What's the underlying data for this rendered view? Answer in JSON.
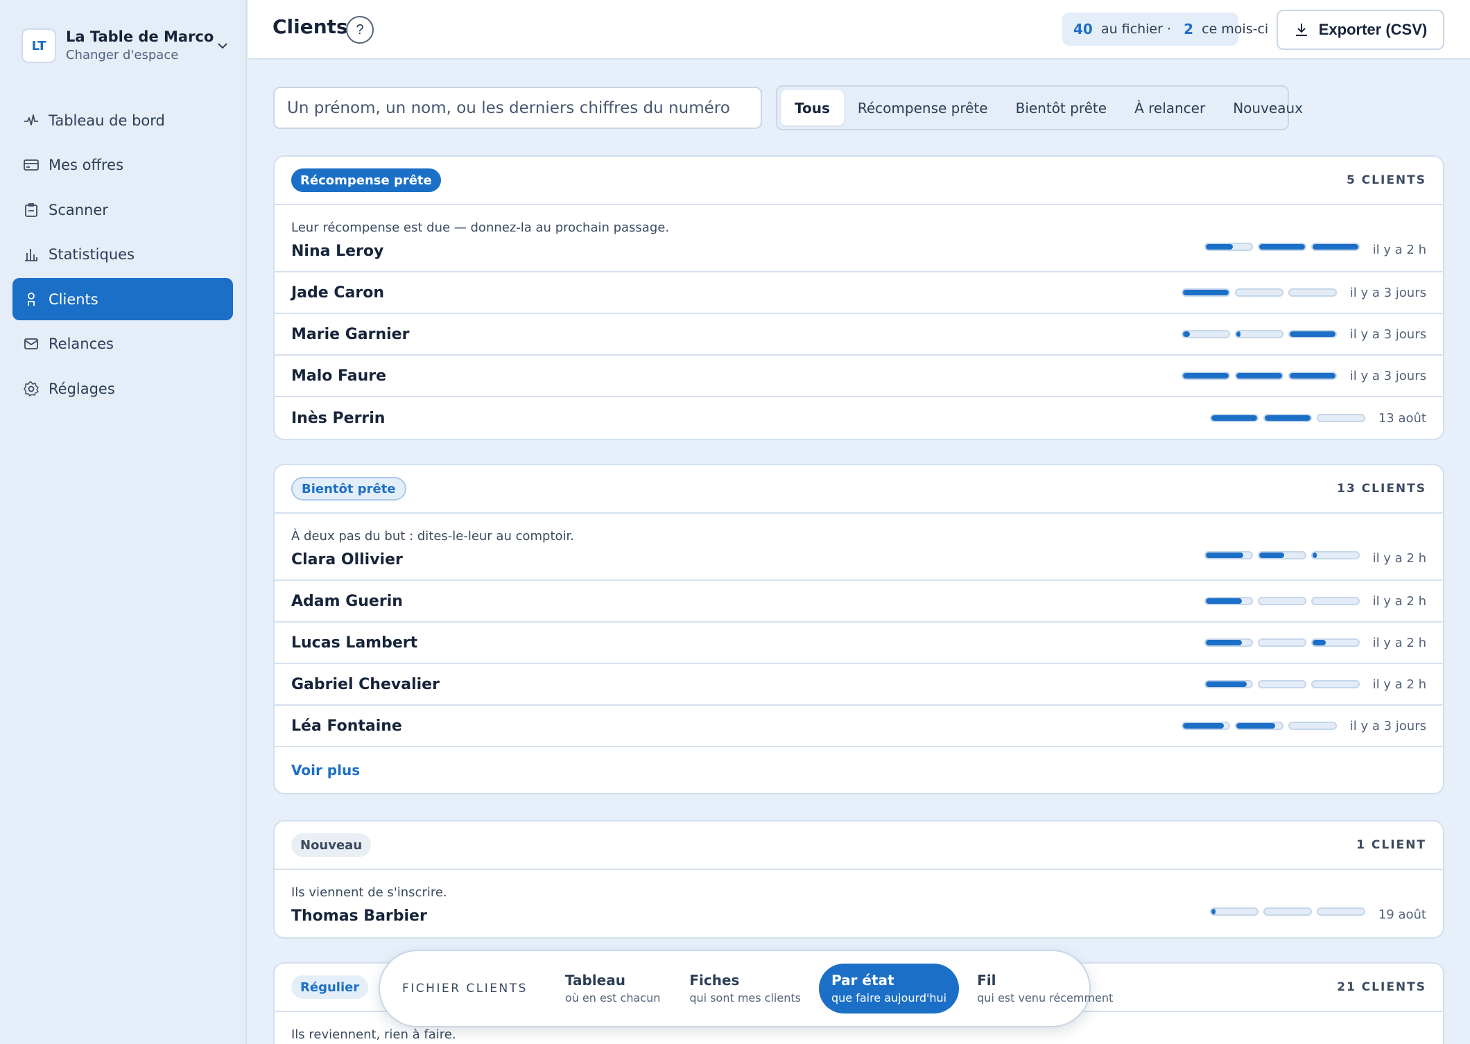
{
  "workspace": {
    "initials": "LT",
    "name": "La Table de Marco",
    "switch_label": "Changer d'espace"
  },
  "sidebar": {
    "items": [
      {
        "label": "Tableau de bord",
        "icon": "pulse-icon",
        "active": false
      },
      {
        "label": "Mes offres",
        "icon": "card-icon",
        "active": false
      },
      {
        "label": "Scanner",
        "icon": "scanner-icon",
        "active": false
      },
      {
        "label": "Statistiques",
        "icon": "bar-chart-icon",
        "active": false
      },
      {
        "label": "Clients",
        "icon": "person-icon",
        "active": true
      },
      {
        "label": "Relances",
        "icon": "mail-icon",
        "active": false
      },
      {
        "label": "Réglages",
        "icon": "gear-icon",
        "active": false
      }
    ]
  },
  "header": {
    "title": "Clients",
    "help": "?",
    "stats": {
      "total": "40",
      "total_label": "au fichier ·",
      "month": "2",
      "month_label": "ce mois-ci"
    },
    "export_label": "Exporter (CSV)"
  },
  "search": {
    "placeholder": "Un prénom, un nom, ou les derniers chiffres du numéro",
    "value": ""
  },
  "filters": [
    "Tous",
    "Récompense prête",
    "Bientôt prête",
    "À relancer",
    "Nouveaux"
  ],
  "active_filter": "Tous",
  "colors": {
    "accent": "#1b6fc7",
    "background": "#e7f0fa",
    "bar_empty": "#e3ecf6"
  },
  "groups": [
    {
      "badge": "Récompense prête",
      "count": "5 CLIENTS",
      "description": "Leur récompense est due — donnez-la au prochain passage.",
      "clients": [
        {
          "name": "Nina Leroy",
          "progress": [
            0.6,
            1,
            1
          ],
          "time": "il y a 2 h"
        },
        {
          "name": "Jade Caron",
          "progress": [
            1,
            0,
            0
          ],
          "time": "il y a 3 jours"
        },
        {
          "name": "Marie Garnier",
          "progress": [
            0.15,
            0.1,
            1
          ],
          "time": "il y a 3 jours"
        },
        {
          "name": "Malo Faure",
          "progress": [
            1,
            1,
            1
          ],
          "time": "il y a 3 jours"
        },
        {
          "name": "Inès Perrin",
          "progress": [
            1,
            1,
            0
          ],
          "time": "13 août"
        }
      ]
    },
    {
      "badge": "Bientôt prête",
      "count": "13 CLIENTS",
      "description": "À deux pas du but : dites-le-leur au comptoir.",
      "more_label": "Voir plus",
      "clients": [
        {
          "name": "Clara Ollivier",
          "progress": [
            0.82,
            0.55,
            0.1
          ],
          "time": "il y a 2 h"
        },
        {
          "name": "Adam Guerin",
          "progress": [
            0.8,
            0,
            0
          ],
          "time": "il y a 2 h"
        },
        {
          "name": "Lucas Lambert",
          "progress": [
            0.8,
            0,
            0.3
          ],
          "time": "il y a 2 h"
        },
        {
          "name": "Gabriel Chevalier",
          "progress": [
            0.9,
            0,
            0
          ],
          "time": "il y a 2 h"
        },
        {
          "name": "Léa Fontaine",
          "progress": [
            0.9,
            0.85,
            0
          ],
          "time": "il y a 3 jours"
        }
      ]
    },
    {
      "badge": "Nouveau",
      "count": "1 CLIENT",
      "description": "Ils viennent de s'inscrire.",
      "clients": [
        {
          "name": "Thomas Barbier",
          "progress": [
            0.1,
            0,
            0
          ],
          "time": "19 août"
        }
      ]
    },
    {
      "badge": "Régulier",
      "count": "21 CLIENTS",
      "description": "Ils reviennent, rien à faire.",
      "clients": []
    }
  ],
  "bottom_nav": {
    "label": "FICHIER CLIENTS",
    "items": [
      {
        "title": "Tableau",
        "subtitle": "où en est chacun",
        "active": false
      },
      {
        "title": "Fiches",
        "subtitle": "qui sont mes clients",
        "active": false
      },
      {
        "title": "Par état",
        "subtitle": "que faire aujourd'hui",
        "active": true
      },
      {
        "title": "Fil",
        "subtitle": "qui est venu récemment",
        "active": false
      }
    ]
  }
}
